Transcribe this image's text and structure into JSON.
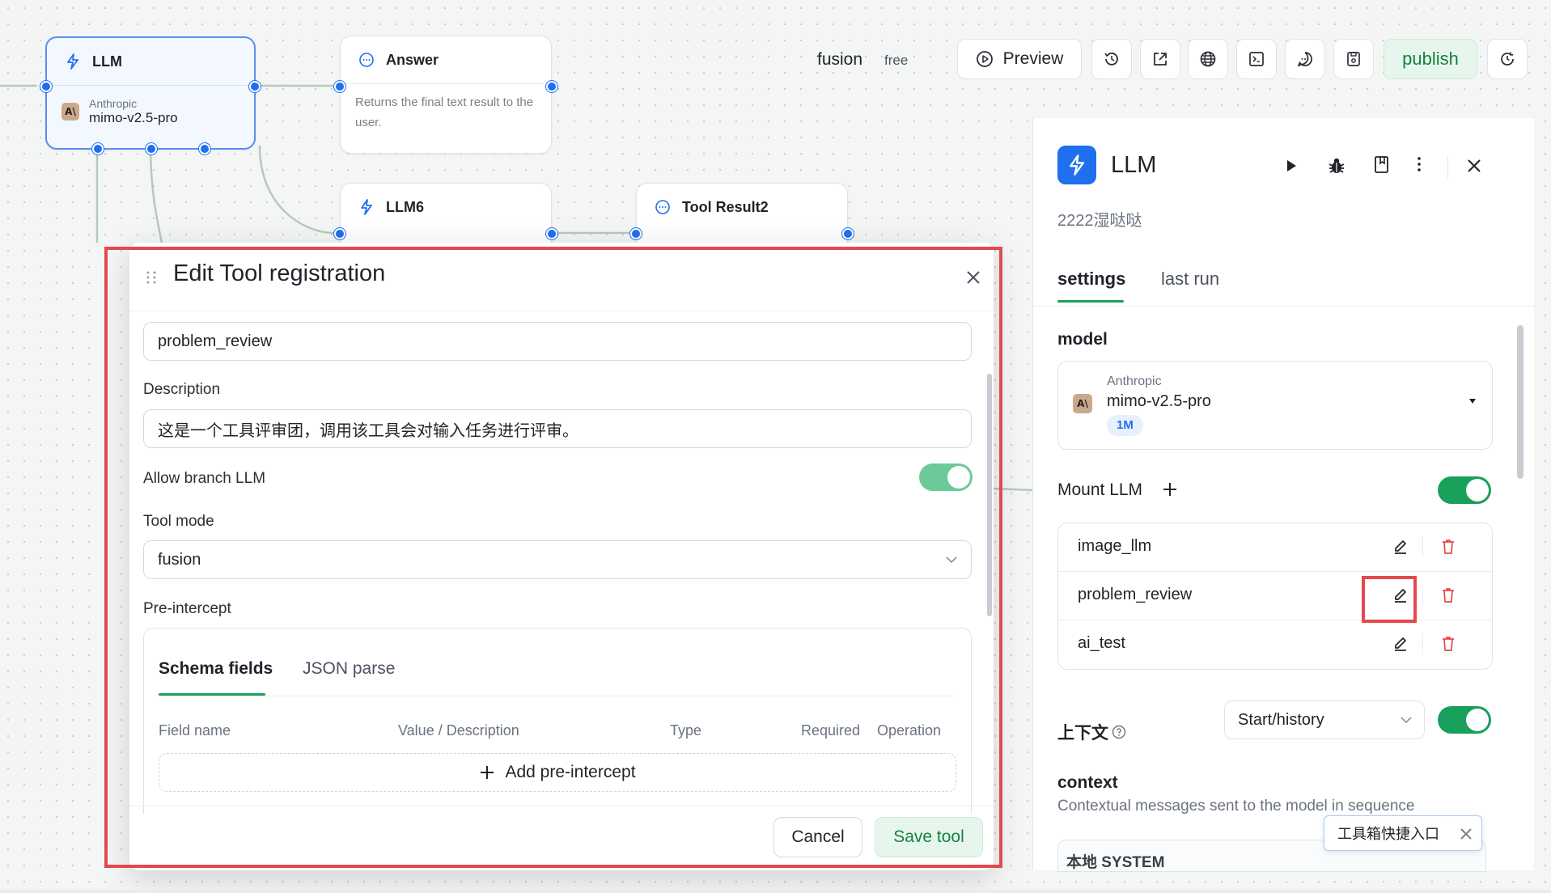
{
  "canvas": {
    "nodes": {
      "llm": {
        "title": "LLM",
        "provider": "Anthropic",
        "model": "mimo-v2.5-pro"
      },
      "answer": {
        "title": "Answer",
        "description": "Returns the final text result to the user."
      },
      "llm6": {
        "title": "LLM6"
      },
      "tool_result2": {
        "title": "Tool Result2"
      }
    }
  },
  "toolbar": {
    "app_name": "fusion",
    "plan": "free",
    "preview_label": "Preview",
    "publish_label": "publish"
  },
  "panel": {
    "title": "LLM",
    "subtitle": "2222湿哒哒",
    "tabs": [
      "settings",
      "last run"
    ],
    "model_label": "model",
    "model": {
      "provider": "Anthropic",
      "name": "mimo-v2.5-pro",
      "badge": "1M"
    },
    "mount_llm_label": "Mount LLM",
    "mounted_tools": [
      "image_llm",
      "problem_review",
      "ai_test"
    ],
    "context_zh_label": "上下文",
    "context_select": "Start/history",
    "context_label": "context",
    "context_desc": "Contextual messages sent to the model in sequence",
    "system_label": "本地 SYSTEM",
    "toolbox_tip": "工具箱快捷入口"
  },
  "modal": {
    "title": "Edit Tool registration",
    "name_value": "problem_review",
    "description_label": "Description",
    "description_value": "这是一个工具评审团，调用该工具会对输入任务进行评审。",
    "allow_branch_label": "Allow branch LLM",
    "tool_mode_label": "Tool mode",
    "tool_mode_value": "fusion",
    "pre_intercept_label": "Pre-intercept",
    "tabs": [
      "Schema fields",
      "JSON parse"
    ],
    "columns": [
      "Field name",
      "Value / Description",
      "Type",
      "Required",
      "Operation"
    ],
    "add_label": "Add pre-intercept",
    "cancel_label": "Cancel",
    "save_label": "Save tool"
  },
  "colors": {
    "accent_blue": "#1f6fef",
    "switch_green": "#19a05a",
    "highlight_red": "#e5484d",
    "delete_red": "#e5484d",
    "publish_bg": "#e7f6ec",
    "publish_text": "#15803d"
  }
}
